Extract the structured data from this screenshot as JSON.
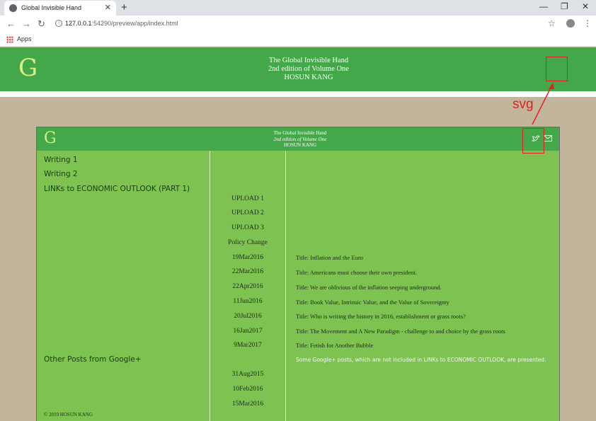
{
  "browser": {
    "tab_title": "Global Invisible Hand",
    "tab_close": "✕",
    "new_tab": "+",
    "url_host": "127.0.0.1",
    "url_path": ":54290/preview/app/index.html",
    "bookmarks_apps": "Apps",
    "controls": {
      "minimize": "—",
      "maximize": "❐",
      "close": "✕",
      "back": "←",
      "forward": "→",
      "reload": "↻",
      "star": "☆",
      "menu": "⋮"
    }
  },
  "header": {
    "logo": "G",
    "title_line1": "The Global Invisible Hand",
    "title_line2": "2nd edition of Volume One",
    "title_line3": "HOSUN KANG"
  },
  "annotation": {
    "label": "svg",
    "color": "#e02020"
  },
  "panel": {
    "logo": "G",
    "title_line1": "The Global Invisible Hand",
    "title_line2": "2nd edition of Volume One",
    "title_line3": "HOSUN KANG",
    "nav": [
      "Writing 1",
      "Writing 2",
      "LINKs to ECONOMIC OUTLOOK (PART 1)",
      "Other Posts from Google+"
    ],
    "middle": [
      "UPLOAD 1",
      "UPLOAD 2",
      "UPLOAD 3",
      "Policy Change",
      "19Mar2016",
      "22Mar2016",
      "22Apr2016",
      "11Jun2016",
      "20Jul2016",
      "16Jan2017",
      "9Mar2017",
      "31Aug2015",
      "10Feb2016",
      "15Mar2016"
    ],
    "titles": [
      "Title: Inflation and the Euro",
      "Title: Americans must choose their own president.",
      "Title: We are oblivious of the inflation seeping underground.",
      "Title: Book Value, Intrinsic Value, and the Value of Sovereignty",
      "Title: Who is writing the history in 2016, establishment or grass roots?",
      "Title: The Movement and A New Paradigm - challenge to and choice by the grass roots",
      "Title: Fetish for Another Bubble"
    ],
    "google_note": "Some Google+ posts, which are not included in LINKs to ECONOMIC OUTLOOK, are presented.",
    "copyright": "© 2019 HOSUN KANG",
    "icons": {
      "twitter": "twitter-icon",
      "mail": "mail-icon"
    }
  },
  "colors": {
    "header_green": "#44a84a",
    "panel_green": "#7ec352",
    "page_bg": "#c3b49c",
    "logo": "#d8ef8a"
  }
}
